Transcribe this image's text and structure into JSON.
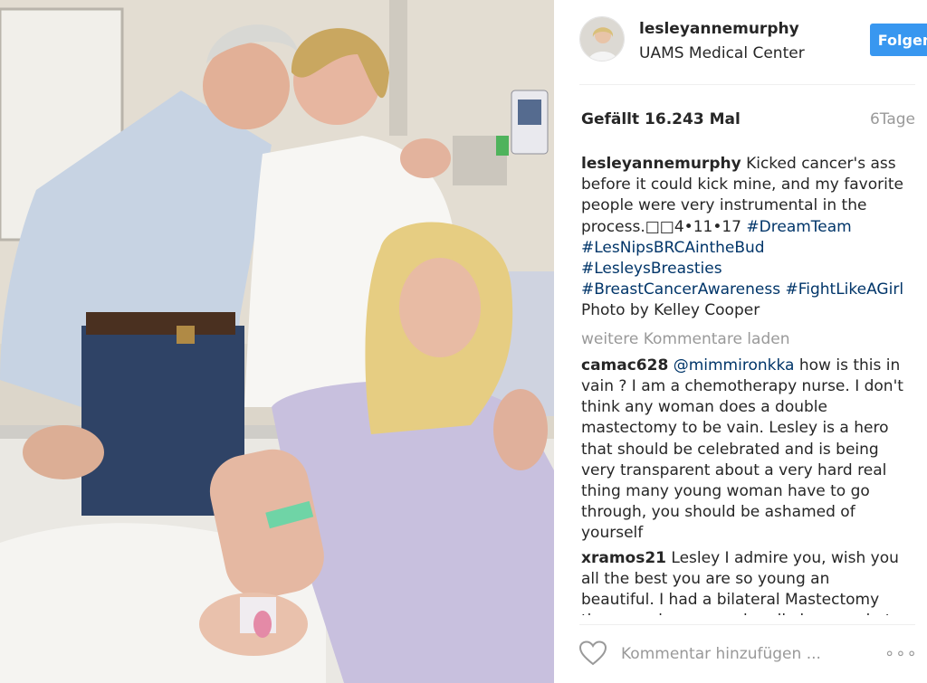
{
  "post": {
    "photo_description": "hospital room photo of three people",
    "header": {
      "username": "lesleyannemurphy",
      "location": "UAMS Medical Center",
      "follow_label": "Folgen"
    },
    "likes": "Gefällt 16.243 Mal",
    "time": "6Tage",
    "caption": {
      "username": "lesleyannemurphy",
      "text": "Kicked cancer's ass before it could kick mine, and my favorite people were very instrumental in the process.□□4•11•17",
      "hashtags": [
        "#DreamTeam",
        "#LesNipsBRCAintheBud",
        "#LesleysBreasties",
        "#BreastCancerAwareness",
        "#FightLikeAGirl"
      ],
      "credit": "Photo by Kelley Cooper"
    },
    "load_more": "weitere Kommentare laden",
    "comments": [
      {
        "username": "camac628",
        "mention": "@mimmironkka",
        "text": "how is this in vain ? I am a chemotherapy nurse. I don't think any woman does a double mastectomy to be vain. Lesley is a hero that should be celebrated and is being very transparent about a very hard real thing many young woman have to go through, you should be ashamed of yourself"
      },
      {
        "username": "xramos21",
        "text": "Lesley I admire you, wish you all the best you are so young an beautiful. I had a bilateral Mastectomy three weeks ago, and really knows what"
      }
    ],
    "comment_placeholder": "Kommentar hinzufügen ...",
    "more_label": "∘∘∘"
  },
  "colors": {
    "accent": "#3897f0",
    "hashtag": "#003569",
    "muted": "#999999",
    "text": "#262626"
  },
  "icons": [
    "heart-icon",
    "more-options-icon"
  ]
}
